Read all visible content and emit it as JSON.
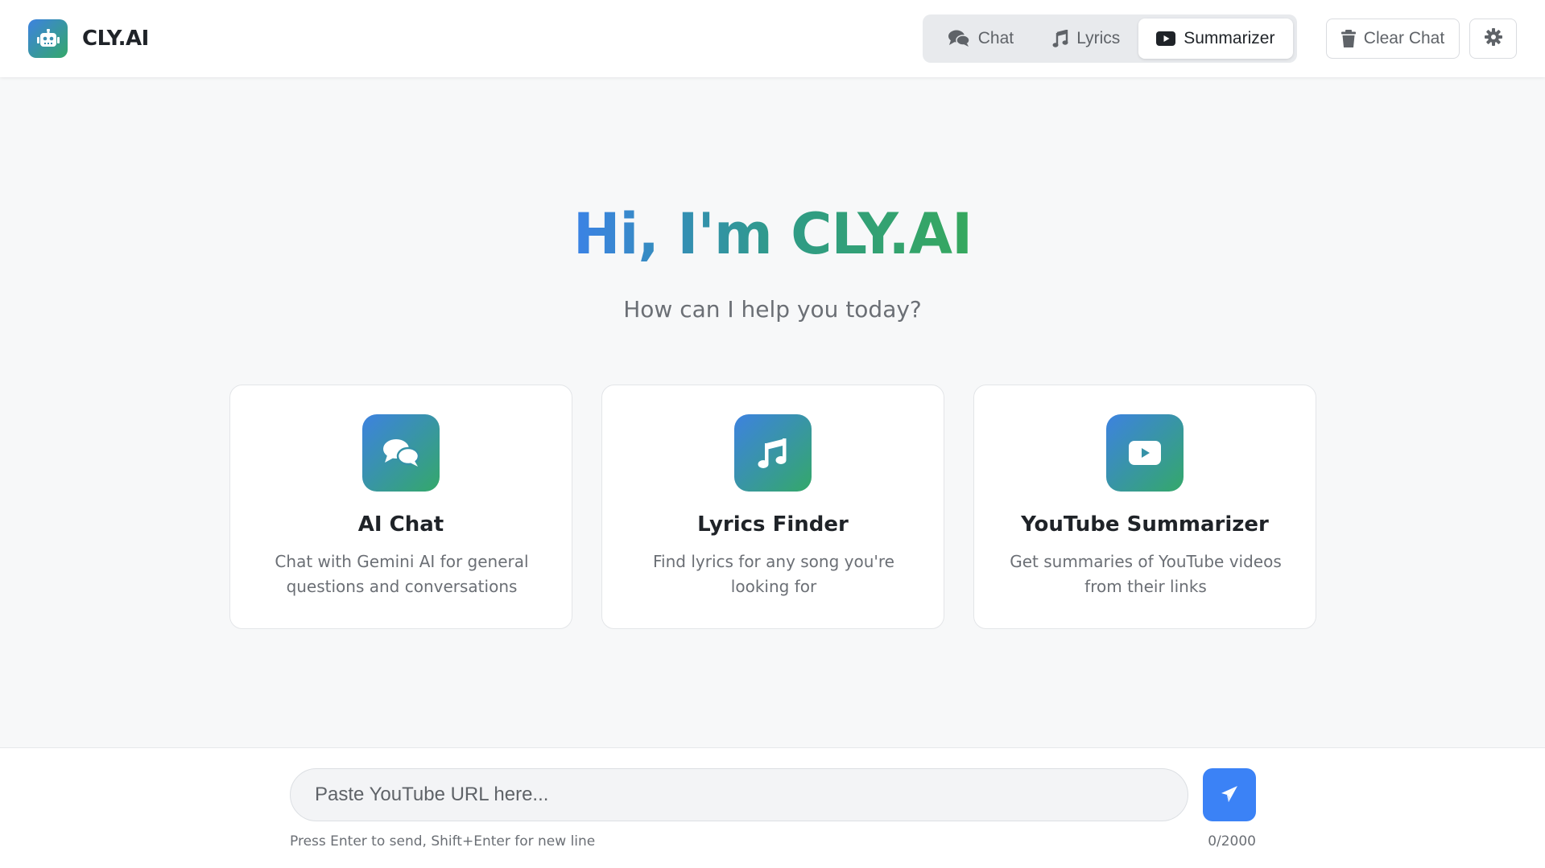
{
  "header": {
    "brand_name": "CLY.AI",
    "brand_icon": "robot-icon",
    "tabs": [
      {
        "label": "Chat",
        "icon": "chat-bubbles-icon",
        "active": false
      },
      {
        "label": "Lyrics",
        "icon": "music-note-icon",
        "active": false
      },
      {
        "label": "Summarizer",
        "icon": "youtube-icon",
        "active": true
      }
    ],
    "clear_label": "Clear Chat",
    "clear_icon": "trash-icon",
    "settings_icon": "gear-icon"
  },
  "hero": {
    "title": "Hi, I'm CLY.AI",
    "subtitle": "How can I help you today?"
  },
  "cards": [
    {
      "title": "AI Chat",
      "description": "Chat with Gemini AI for general questions and conversations",
      "icon": "chat-bubbles-icon"
    },
    {
      "title": "Lyrics Finder",
      "description": "Find lyrics for any song you're looking for",
      "icon": "music-note-icon"
    },
    {
      "title": "YouTube Summarizer",
      "description": "Get summaries of YouTube videos from their links",
      "icon": "youtube-icon"
    }
  ],
  "composer": {
    "placeholder": "Paste YouTube URL here...",
    "value": "",
    "hint": "Press Enter to send, Shift+Enter for new line",
    "counter": "0/2000",
    "send_icon": "paper-plane-icon"
  },
  "colors": {
    "accent_blue": "#3b82f6",
    "gradient_start": "#3d82e0",
    "gradient_end": "#34a86a",
    "background": "#f7f8f9"
  }
}
